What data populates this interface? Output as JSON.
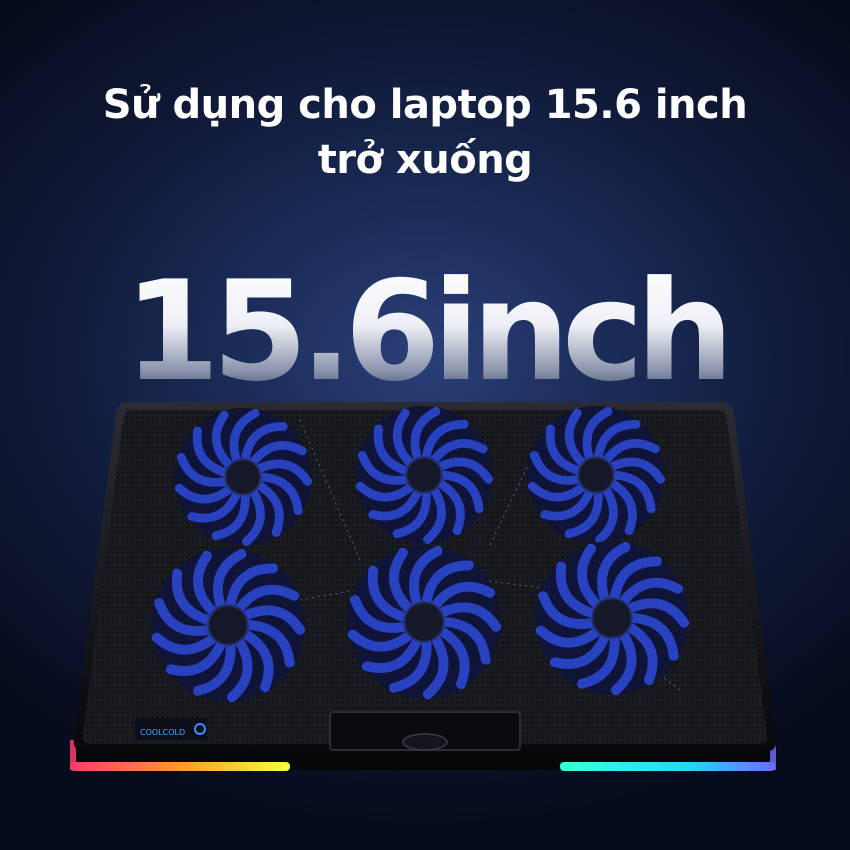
{
  "headline": {
    "line1": "Sử dụng cho laptop 15.6 inch",
    "line2": "trở xuống"
  },
  "size_label": "15.6inch",
  "product": {
    "fan_count": 6,
    "brand_logo_text": "COOLCOLD",
    "fan_color": "#2f52ff",
    "rgb_left_colors": [
      "#ff3b6e",
      "#ff9a2e",
      "#f5ff3a"
    ],
    "rgb_right_colors": [
      "#3affd8",
      "#27d6ff",
      "#6b6bff"
    ]
  }
}
